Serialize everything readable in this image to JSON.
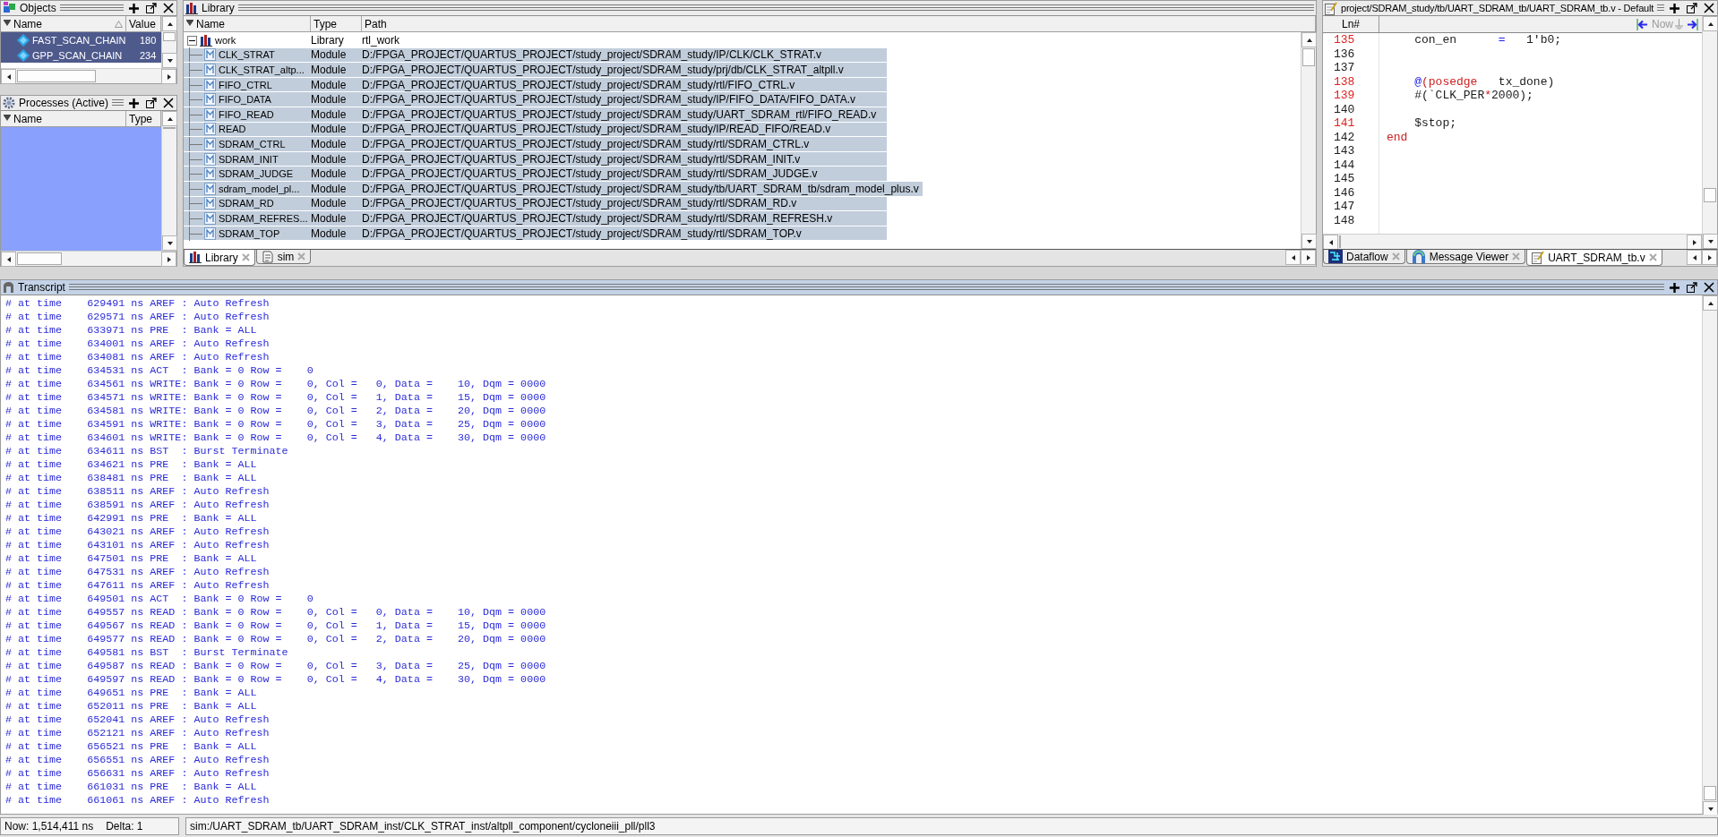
{
  "objects": {
    "title": "Objects",
    "active": false,
    "columns": [
      "Name",
      "Value"
    ],
    "rows": [
      {
        "name": "FAST_SCAN_CHAIN",
        "value": "180",
        "selected": true
      },
      {
        "name": "GPP_SCAN_CHAIN",
        "value": "234",
        "selected": true
      }
    ]
  },
  "processes": {
    "title": "Processes (Active)",
    "active": false,
    "columns": [
      "Name",
      "Type"
    ]
  },
  "library": {
    "title": "Library",
    "active": false,
    "columns": [
      "Name",
      "Type",
      "Path"
    ],
    "tree": [
      {
        "name": "work",
        "type": "Library",
        "path": "rtl_work",
        "expanded": true,
        "children": [
          {
            "name": "CLK_STRAT",
            "type": "Module",
            "path": "D:/FPGA_PROJECT/QUARTUS_PROJECT/study_project/SDRAM_study/IP/CLK/CLK_STRAT.v",
            "selected": true
          },
          {
            "name": "CLK_STRAT_altp...",
            "type": "Module",
            "path": "D:/FPGA_PROJECT/QUARTUS_PROJECT/study_project/SDRAM_study/prj/db/CLK_STRAT_altpll.v",
            "selected": true
          },
          {
            "name": "FIFO_CTRL",
            "type": "Module",
            "path": "D:/FPGA_PROJECT/QUARTUS_PROJECT/study_project/SDRAM_study/rtl/FIFO_CTRL.v",
            "selected": true
          },
          {
            "name": "FIFO_DATA",
            "type": "Module",
            "path": "D:/FPGA_PROJECT/QUARTUS_PROJECT/study_project/SDRAM_study/IP/FIFO_DATA/FIFO_DATA.v",
            "selected": true
          },
          {
            "name": "FIFO_READ",
            "type": "Module",
            "path": "D:/FPGA_PROJECT/QUARTUS_PROJECT/study_project/SDRAM_study/UART_SDRAM_rtl/FIFO_READ.v",
            "selected": true
          },
          {
            "name": "READ",
            "type": "Module",
            "path": "D:/FPGA_PROJECT/QUARTUS_PROJECT/study_project/SDRAM_study/IP/READ_FIFO/READ.v",
            "selected": true
          },
          {
            "name": "SDRAM_CTRL",
            "type": "Module",
            "path": "D:/FPGA_PROJECT/QUARTUS_PROJECT/study_project/SDRAM_study/rtl/SDRAM_CTRL.v",
            "selected": true
          },
          {
            "name": "SDRAM_INIT",
            "type": "Module",
            "path": "D:/FPGA_PROJECT/QUARTUS_PROJECT/study_project/SDRAM_study/rtl/SDRAM_INIT.v",
            "selected": true
          },
          {
            "name": "SDRAM_JUDGE",
            "type": "Module",
            "path": "D:/FPGA_PROJECT/QUARTUS_PROJECT/study_project/SDRAM_study/rtl/SDRAM_JUDGE.v",
            "selected": true
          },
          {
            "name": "sdram_model_pl...",
            "type": "Module",
            "path": "D:/FPGA_PROJECT/QUARTUS_PROJECT/study_project/SDRAM_study/tb/UART_SDRAM_tb/sdram_model_plus.v",
            "selected": true
          },
          {
            "name": "SDRAM_RD",
            "type": "Module",
            "path": "D:/FPGA_PROJECT/QUARTUS_PROJECT/study_project/SDRAM_study/rtl/SDRAM_RD.v",
            "selected": true
          },
          {
            "name": "SDRAM_REFRES...",
            "type": "Module",
            "path": "D:/FPGA_PROJECT/QUARTUS_PROJECT/study_project/SDRAM_study/rtl/SDRAM_REFRESH.v",
            "selected": true
          },
          {
            "name": "SDRAM_TOP",
            "type": "Module",
            "path": "D:/FPGA_PROJECT/QUARTUS_PROJECT/study_project/SDRAM_study/rtl/SDRAM_TOP.v",
            "selected": true
          }
        ]
      }
    ],
    "tabs": [
      {
        "label": "Library",
        "kind": "library",
        "selected": true
      },
      {
        "label": "sim",
        "kind": "sim",
        "selected": false
      }
    ]
  },
  "editor": {
    "title": "project/SDRAM_study/tb/UART_SDRAM_tb/UART_SDRAM_tb.v - Default",
    "active": false,
    "line_header": "Ln#",
    "now_label": "Now",
    "lines": [
      {
        "number": "135",
        "executable": true,
        "tokens": [
          {
            "text": "    con_en      ",
            "kind": "plain"
          },
          {
            "text": "=",
            "kind": "operator"
          },
          {
            "text": "   1'b0;",
            "kind": "plain"
          }
        ]
      },
      {
        "number": "136",
        "executable": false
      },
      {
        "number": "137",
        "executable": false
      },
      {
        "number": "138",
        "executable": true,
        "tokens": [
          {
            "text": "    @",
            "kind": "operator"
          },
          {
            "text": "(posedge",
            "kind": "keyword"
          },
          {
            "text": "   tx_done)",
            "kind": "plain"
          }
        ]
      },
      {
        "number": "139",
        "executable": true,
        "tokens": [
          {
            "text": "    #(`CLK_PER",
            "kind": "plain"
          },
          {
            "text": "*",
            "kind": "keyword"
          },
          {
            "text": "2000);",
            "kind": "plain"
          }
        ]
      },
      {
        "number": "140",
        "executable": false
      },
      {
        "number": "141",
        "executable": true,
        "tokens": [
          {
            "text": "    $stop;",
            "kind": "plain"
          }
        ]
      },
      {
        "number": "142",
        "executable": false,
        "tokens": [
          {
            "text": "end",
            "kind": "keyword"
          }
        ]
      },
      {
        "number": "143",
        "executable": false
      },
      {
        "number": "144",
        "executable": false
      },
      {
        "number": "145",
        "executable": false
      },
      {
        "number": "146",
        "executable": false
      },
      {
        "number": "147",
        "executable": false
      },
      {
        "number": "148",
        "executable": false
      }
    ],
    "tabs": [
      {
        "label": "Dataflow",
        "kind": "dataflow",
        "selected": false
      },
      {
        "label": "Message Viewer",
        "kind": "messages",
        "selected": false
      },
      {
        "label": "UART_SDRAM_tb.v",
        "kind": "source",
        "selected": true
      }
    ]
  },
  "transcript": {
    "title": "Transcript",
    "active": true,
    "lines": [
      "# at time    629491 ns AREF : Auto Refresh",
      "# at time    629571 ns AREF : Auto Refresh",
      "# at time    633971 ns PRE  : Bank = ALL",
      "# at time    634001 ns AREF : Auto Refresh",
      "# at time    634081 ns AREF : Auto Refresh",
      "# at time    634531 ns ACT  : Bank = 0 Row =    0",
      "# at time    634561 ns WRITE: Bank = 0 Row =    0, Col =   0, Data =    10, Dqm = 0000",
      "# at time    634571 ns WRITE: Bank = 0 Row =    0, Col =   1, Data =    15, Dqm = 0000",
      "# at time    634581 ns WRITE: Bank = 0 Row =    0, Col =   2, Data =    20, Dqm = 0000",
      "# at time    634591 ns WRITE: Bank = 0 Row =    0, Col =   3, Data =    25, Dqm = 0000",
      "# at time    634601 ns WRITE: Bank = 0 Row =    0, Col =   4, Data =    30, Dqm = 0000",
      "# at time    634611 ns BST  : Burst Terminate",
      "# at time    634621 ns PRE  : Bank = ALL",
      "# at time    638481 ns PRE  : Bank = ALL",
      "# at time    638511 ns AREF : Auto Refresh",
      "# at time    638591 ns AREF : Auto Refresh",
      "# at time    642991 ns PRE  : Bank = ALL",
      "# at time    643021 ns AREF : Auto Refresh",
      "# at time    643101 ns AREF : Auto Refresh",
      "# at time    647501 ns PRE  : Bank = ALL",
      "# at time    647531 ns AREF : Auto Refresh",
      "# at time    647611 ns AREF : Auto Refresh",
      "# at time    649501 ns ACT  : Bank = 0 Row =    0",
      "# at time    649557 ns READ : Bank = 0 Row =    0, Col =   0, Data =    10, Dqm = 0000",
      "# at time    649567 ns READ : Bank = 0 Row =    0, Col =   1, Data =    15, Dqm = 0000",
      "# at time    649577 ns READ : Bank = 0 Row =    0, Col =   2, Data =    20, Dqm = 0000",
      "# at time    649581 ns BST  : Burst Terminate",
      "# at time    649587 ns READ : Bank = 0 Row =    0, Col =   3, Data =    25, Dqm = 0000",
      "# at time    649597 ns READ : Bank = 0 Row =    0, Col =   4, Data =    30, Dqm = 0000",
      "# at time    649651 ns PRE  : Bank = ALL",
      "# at time    652011 ns PRE  : Bank = ALL",
      "# at time    652041 ns AREF : Auto Refresh",
      "# at time    652121 ns AREF : Auto Refresh",
      "# at time    656521 ns PRE  : Bank = ALL",
      "# at time    656551 ns AREF : Auto Refresh",
      "# at time    656631 ns AREF : Auto Refresh",
      "# at time    661031 ns PRE  : Bank = ALL",
      "# at time    661061 ns AREF : Auto Refresh"
    ]
  },
  "status_bar": {
    "now": "Now: 1,514,411 ns",
    "delta": "Delta: 1",
    "path": "sim:/UART_SDRAM_tb/UART_SDRAM_inst/CLK_STRAT_inst/altpll_component/cycloneiii_pll/pll3"
  }
}
